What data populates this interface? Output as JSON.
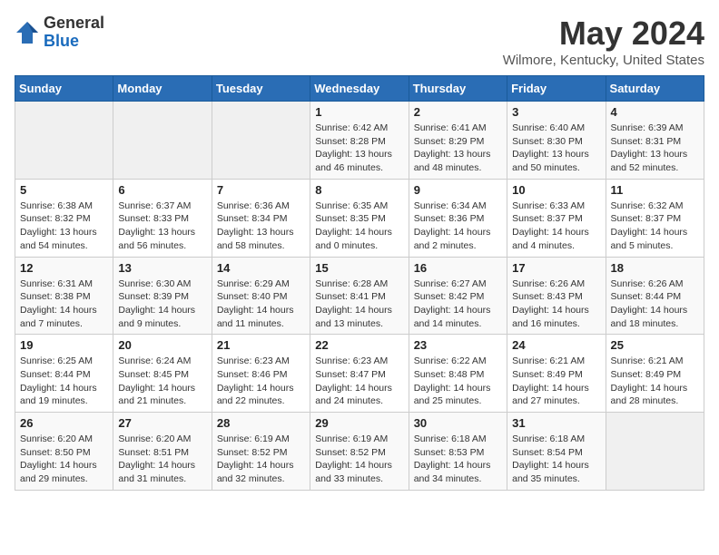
{
  "header": {
    "logo_general": "General",
    "logo_blue": "Blue",
    "title": "May 2024",
    "location": "Wilmore, Kentucky, United States"
  },
  "calendar": {
    "days_of_week": [
      "Sunday",
      "Monday",
      "Tuesday",
      "Wednesday",
      "Thursday",
      "Friday",
      "Saturday"
    ],
    "weeks": [
      [
        {
          "day": "",
          "info": ""
        },
        {
          "day": "",
          "info": ""
        },
        {
          "day": "",
          "info": ""
        },
        {
          "day": "1",
          "info": "Sunrise: 6:42 AM\nSunset: 8:28 PM\nDaylight: 13 hours and 46 minutes."
        },
        {
          "day": "2",
          "info": "Sunrise: 6:41 AM\nSunset: 8:29 PM\nDaylight: 13 hours and 48 minutes."
        },
        {
          "day": "3",
          "info": "Sunrise: 6:40 AM\nSunset: 8:30 PM\nDaylight: 13 hours and 50 minutes."
        },
        {
          "day": "4",
          "info": "Sunrise: 6:39 AM\nSunset: 8:31 PM\nDaylight: 13 hours and 52 minutes."
        }
      ],
      [
        {
          "day": "5",
          "info": "Sunrise: 6:38 AM\nSunset: 8:32 PM\nDaylight: 13 hours and 54 minutes."
        },
        {
          "day": "6",
          "info": "Sunrise: 6:37 AM\nSunset: 8:33 PM\nDaylight: 13 hours and 56 minutes."
        },
        {
          "day": "7",
          "info": "Sunrise: 6:36 AM\nSunset: 8:34 PM\nDaylight: 13 hours and 58 minutes."
        },
        {
          "day": "8",
          "info": "Sunrise: 6:35 AM\nSunset: 8:35 PM\nDaylight: 14 hours and 0 minutes."
        },
        {
          "day": "9",
          "info": "Sunrise: 6:34 AM\nSunset: 8:36 PM\nDaylight: 14 hours and 2 minutes."
        },
        {
          "day": "10",
          "info": "Sunrise: 6:33 AM\nSunset: 8:37 PM\nDaylight: 14 hours and 4 minutes."
        },
        {
          "day": "11",
          "info": "Sunrise: 6:32 AM\nSunset: 8:37 PM\nDaylight: 14 hours and 5 minutes."
        }
      ],
      [
        {
          "day": "12",
          "info": "Sunrise: 6:31 AM\nSunset: 8:38 PM\nDaylight: 14 hours and 7 minutes."
        },
        {
          "day": "13",
          "info": "Sunrise: 6:30 AM\nSunset: 8:39 PM\nDaylight: 14 hours and 9 minutes."
        },
        {
          "day": "14",
          "info": "Sunrise: 6:29 AM\nSunset: 8:40 PM\nDaylight: 14 hours and 11 minutes."
        },
        {
          "day": "15",
          "info": "Sunrise: 6:28 AM\nSunset: 8:41 PM\nDaylight: 14 hours and 13 minutes."
        },
        {
          "day": "16",
          "info": "Sunrise: 6:27 AM\nSunset: 8:42 PM\nDaylight: 14 hours and 14 minutes."
        },
        {
          "day": "17",
          "info": "Sunrise: 6:26 AM\nSunset: 8:43 PM\nDaylight: 14 hours and 16 minutes."
        },
        {
          "day": "18",
          "info": "Sunrise: 6:26 AM\nSunset: 8:44 PM\nDaylight: 14 hours and 18 minutes."
        }
      ],
      [
        {
          "day": "19",
          "info": "Sunrise: 6:25 AM\nSunset: 8:44 PM\nDaylight: 14 hours and 19 minutes."
        },
        {
          "day": "20",
          "info": "Sunrise: 6:24 AM\nSunset: 8:45 PM\nDaylight: 14 hours and 21 minutes."
        },
        {
          "day": "21",
          "info": "Sunrise: 6:23 AM\nSunset: 8:46 PM\nDaylight: 14 hours and 22 minutes."
        },
        {
          "day": "22",
          "info": "Sunrise: 6:23 AM\nSunset: 8:47 PM\nDaylight: 14 hours and 24 minutes."
        },
        {
          "day": "23",
          "info": "Sunrise: 6:22 AM\nSunset: 8:48 PM\nDaylight: 14 hours and 25 minutes."
        },
        {
          "day": "24",
          "info": "Sunrise: 6:21 AM\nSunset: 8:49 PM\nDaylight: 14 hours and 27 minutes."
        },
        {
          "day": "25",
          "info": "Sunrise: 6:21 AM\nSunset: 8:49 PM\nDaylight: 14 hours and 28 minutes."
        }
      ],
      [
        {
          "day": "26",
          "info": "Sunrise: 6:20 AM\nSunset: 8:50 PM\nDaylight: 14 hours and 29 minutes."
        },
        {
          "day": "27",
          "info": "Sunrise: 6:20 AM\nSunset: 8:51 PM\nDaylight: 14 hours and 31 minutes."
        },
        {
          "day": "28",
          "info": "Sunrise: 6:19 AM\nSunset: 8:52 PM\nDaylight: 14 hours and 32 minutes."
        },
        {
          "day": "29",
          "info": "Sunrise: 6:19 AM\nSunset: 8:52 PM\nDaylight: 14 hours and 33 minutes."
        },
        {
          "day": "30",
          "info": "Sunrise: 6:18 AM\nSunset: 8:53 PM\nDaylight: 14 hours and 34 minutes."
        },
        {
          "day": "31",
          "info": "Sunrise: 6:18 AM\nSunset: 8:54 PM\nDaylight: 14 hours and 35 minutes."
        },
        {
          "day": "",
          "info": ""
        }
      ]
    ]
  }
}
